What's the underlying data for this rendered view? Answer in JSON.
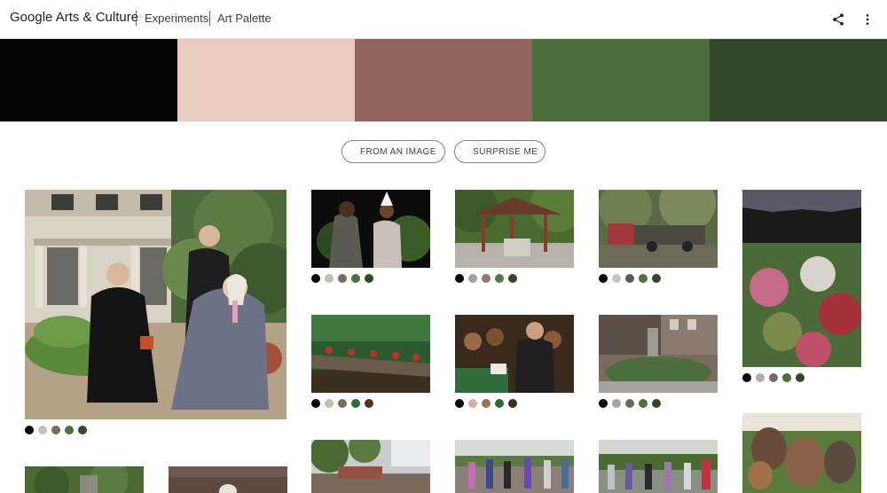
{
  "header": {
    "brand": "Google Arts & Culture",
    "crumb1": "Experiments",
    "crumb2": "Art Palette",
    "share_icon": "share-icon",
    "more_icon": "more-vertical-icon"
  },
  "palette": [
    "#050404",
    "#e9cabe",
    "#936460",
    "#4d6e3d",
    "#334829"
  ],
  "buttons": {
    "from_image": "FROM AN IMAGE",
    "surprise": "SURPRISE ME"
  },
  "results": [
    {
      "name": "result-mansion-painting",
      "colors": [
        "#050404",
        "#c9bdb1",
        "#7a6a5c",
        "#4d6e3d",
        "#334829"
      ]
    },
    {
      "name": "result-performers-photo",
      "colors": [
        "#050404",
        "#c9bdb1",
        "#7a6a5c",
        "#4d6e3d",
        "#334829"
      ]
    },
    {
      "name": "result-pavilion-photo",
      "colors": [
        "#050404",
        "#a8a29c",
        "#8a7a70",
        "#4d7a46",
        "#334829"
      ]
    },
    {
      "name": "result-old-truck-photo",
      "colors": [
        "#050404",
        "#c9c4bd",
        "#5c5a50",
        "#4d6e3d",
        "#334829"
      ]
    },
    {
      "name": "result-rowers-photo",
      "colors": [
        "#050404",
        "#c9bdb1",
        "#7a6a5c",
        "#2f6b3b",
        "#4a3424"
      ]
    },
    {
      "name": "result-speaker-photo",
      "colors": [
        "#050404",
        "#c9b5a0",
        "#9a7450",
        "#2f6b3b",
        "#3a3020"
      ]
    },
    {
      "name": "result-garden-photo",
      "colors": [
        "#050404",
        "#a8a29c",
        "#6a6a60",
        "#4d6e3d",
        "#334829"
      ]
    },
    {
      "name": "result-flower-garden-photo",
      "colors": [
        "#050404",
        "#b3aaa5",
        "#7a6570",
        "#4d6e3d",
        "#334829"
      ]
    },
    {
      "name": "result-pottery-photo",
      "colors": []
    },
    {
      "name": "result-trees-photo",
      "colors": []
    },
    {
      "name": "result-still-life-photo",
      "colors": []
    },
    {
      "name": "result-waterfront-photo",
      "colors": []
    },
    {
      "name": "result-crowd-photo",
      "colors": []
    },
    {
      "name": "result-group-photo",
      "colors": []
    }
  ]
}
